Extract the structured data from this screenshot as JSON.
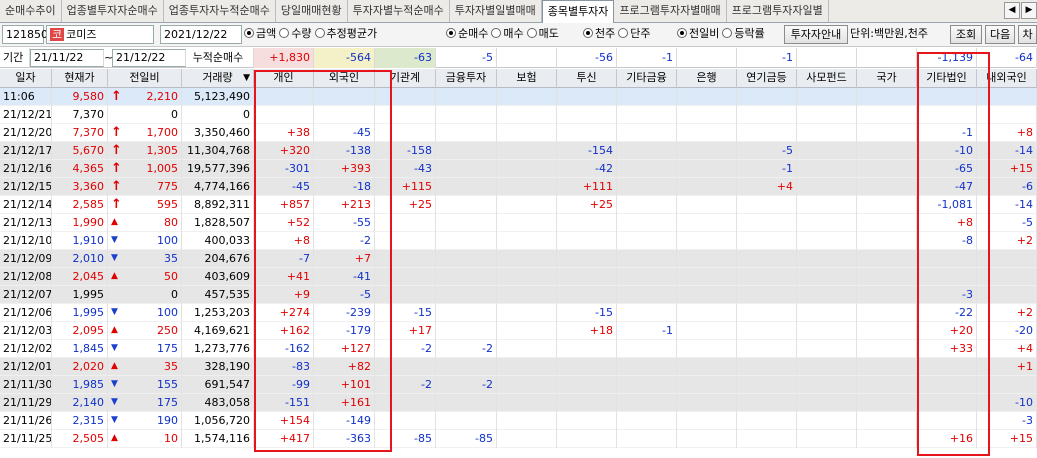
{
  "tabs": [
    "순매수추이",
    "업종별투자자순매수",
    "업종투자자누적순매수",
    "당일매매현황",
    "투자자별누적순매수",
    "투자자별일별매매",
    "종목별투자자",
    "프로그램투자자별매매",
    "프로그램투자자일별"
  ],
  "active_tab": 6,
  "tab_arrows": {
    "left": "◀",
    "right": "▶"
  },
  "toolbar": {
    "code": "121850",
    "market_tag": "코",
    "name": "코미즈",
    "date": "2021/12/22",
    "radios_value": [
      {
        "label": "금액",
        "on": true
      },
      {
        "label": "수량",
        "on": false
      },
      {
        "label": "추정평균가",
        "on": false
      }
    ],
    "radios_side": [
      {
        "label": "순매수",
        "on": true
      },
      {
        "label": "매수",
        "on": false
      },
      {
        "label": "매도",
        "on": false
      }
    ],
    "radios_unit": [
      {
        "label": "천주",
        "on": true
      },
      {
        "label": "단주",
        "on": false
      }
    ],
    "radios_cmp": [
      {
        "label": "전일비",
        "on": true
      },
      {
        "label": "등락률",
        "on": false
      }
    ],
    "investor_btn": "투자자안내",
    "unit_label": "단위:백만원,천주",
    "query_btn": "조회",
    "next_btn": "다음",
    "extra_btn": "차"
  },
  "period": {
    "label": "기간",
    "from": "21/11/22",
    "sep": "~",
    "to": "21/12/22",
    "cum_label": "누적순매수"
  },
  "cumulative": {
    "individual": "+1,830",
    "foreign": "-564",
    "institution": "-63",
    "fin_invest": "-5",
    "insurance": "",
    "trust": "-56",
    "other_fin": "-1",
    "bank": "",
    "pension": "-1",
    "pef": "",
    "nation": "",
    "other_corp": "-1,139",
    "dom_foreign": "-64"
  },
  "headers": [
    "일자",
    "현재가",
    "전일비",
    "거래량",
    "개인",
    "외국인",
    "기관계",
    "금융투자",
    "보험",
    "투신",
    "기타금융",
    "은행",
    "연기금등",
    "사모펀드",
    "국가",
    "기타법인",
    "내외국인"
  ],
  "sort_icon": "▼",
  "rows": [
    {
      "date": "11:06",
      "price": "9,580",
      "dir": "up",
      "chg": "2,210",
      "vol": "5,123,490",
      "ind": "",
      "for": "",
      "inst": "",
      "fin": "",
      "ins": "",
      "trust": "",
      "ofin": "",
      "bank": "",
      "pen": "",
      "pef": "",
      "nat": "",
      "ocorp": "",
      "dfor": "",
      "style": "now"
    },
    {
      "date": "21/12/21",
      "price": "7,370",
      "dir": "",
      "chg": "0",
      "vol": "0",
      "ind": "",
      "for": "",
      "inst": "",
      "fin": "",
      "ins": "",
      "trust": "",
      "ofin": "",
      "bank": "",
      "pen": "",
      "pef": "",
      "nat": "",
      "ocorp": "",
      "dfor": "",
      "style": ""
    },
    {
      "date": "21/12/20",
      "price": "7,370",
      "dir": "up",
      "chg": "1,700",
      "vol": "3,350,460",
      "ind": "+38",
      "for": "-45",
      "inst": "",
      "fin": "",
      "ins": "",
      "trust": "",
      "ofin": "",
      "bank": "",
      "pen": "",
      "pef": "",
      "nat": "",
      "ocorp": "-1",
      "dfor": "+8",
      "style": ""
    },
    {
      "date": "21/12/17",
      "price": "5,670",
      "dir": "up",
      "chg": "1,305",
      "vol": "11,304,768",
      "ind": "+320",
      "for": "-138",
      "inst": "-158",
      "fin": "",
      "ins": "",
      "trust": "-154",
      "ofin": "",
      "bank": "",
      "pen": "-5",
      "pef": "",
      "nat": "",
      "ocorp": "-10",
      "dfor": "-14",
      "style": "gray"
    },
    {
      "date": "21/12/16",
      "price": "4,365",
      "dir": "up",
      "chg": "1,005",
      "vol": "19,577,396",
      "ind": "-301",
      "for": "+393",
      "inst": "-43",
      "fin": "",
      "ins": "",
      "trust": "-42",
      "ofin": "",
      "bank": "",
      "pen": "-1",
      "pef": "",
      "nat": "",
      "ocorp": "-65",
      "dfor": "+15",
      "style": "gray"
    },
    {
      "date": "21/12/15",
      "price": "3,360",
      "dir": "up",
      "chg": "775",
      "vol": "4,774,166",
      "ind": "-45",
      "for": "-18",
      "inst": "+115",
      "fin": "",
      "ins": "",
      "trust": "+111",
      "ofin": "",
      "bank": "",
      "pen": "+4",
      "pef": "",
      "nat": "",
      "ocorp": "-47",
      "dfor": "-6",
      "style": "gray"
    },
    {
      "date": "21/12/14",
      "price": "2,585",
      "dir": "up",
      "chg": "595",
      "vol": "8,892,311",
      "ind": "+857",
      "for": "+213",
      "inst": "+25",
      "fin": "",
      "ins": "",
      "trust": "+25",
      "ofin": "",
      "bank": "",
      "pen": "",
      "pef": "",
      "nat": "",
      "ocorp": "-1,081",
      "dfor": "-14",
      "style": ""
    },
    {
      "date": "21/12/13",
      "price": "1,990",
      "dir": "tri-up",
      "chg": "80",
      "vol": "1,828,507",
      "ind": "+52",
      "for": "-55",
      "inst": "",
      "fin": "",
      "ins": "",
      "trust": "",
      "ofin": "",
      "bank": "",
      "pen": "",
      "pef": "",
      "nat": "",
      "ocorp": "+8",
      "dfor": "-5",
      "style": ""
    },
    {
      "date": "21/12/10",
      "price": "1,910",
      "dir": "tri-dn",
      "chg": "100",
      "vol": "400,033",
      "ind": "+8",
      "for": "-2",
      "inst": "",
      "fin": "",
      "ins": "",
      "trust": "",
      "ofin": "",
      "bank": "",
      "pen": "",
      "pef": "",
      "nat": "",
      "ocorp": "-8",
      "dfor": "+2",
      "style": ""
    },
    {
      "date": "21/12/09",
      "price": "2,010",
      "dir": "tri-dn",
      "chg": "35",
      "vol": "204,676",
      "ind": "-7",
      "for": "+7",
      "inst": "",
      "fin": "",
      "ins": "",
      "trust": "",
      "ofin": "",
      "bank": "",
      "pen": "",
      "pef": "",
      "nat": "",
      "ocorp": "",
      "dfor": "",
      "style": "gray"
    },
    {
      "date": "21/12/08",
      "price": "2,045",
      "dir": "tri-up",
      "chg": "50",
      "vol": "403,609",
      "ind": "+41",
      "for": "-41",
      "inst": "",
      "fin": "",
      "ins": "",
      "trust": "",
      "ofin": "",
      "bank": "",
      "pen": "",
      "pef": "",
      "nat": "",
      "ocorp": "",
      "dfor": "",
      "style": "gray"
    },
    {
      "date": "21/12/07",
      "price": "1,995",
      "dir": "",
      "chg": "0",
      "vol": "457,535",
      "ind": "+9",
      "for": "-5",
      "inst": "",
      "fin": "",
      "ins": "",
      "trust": "",
      "ofin": "",
      "bank": "",
      "pen": "",
      "pef": "",
      "nat": "",
      "ocorp": "-3",
      "dfor": "",
      "style": "gray"
    },
    {
      "date": "21/12/06",
      "price": "1,995",
      "dir": "tri-dn",
      "chg": "100",
      "vol": "1,253,203",
      "ind": "+274",
      "for": "-239",
      "inst": "-15",
      "fin": "",
      "ins": "",
      "trust": "-15",
      "ofin": "",
      "bank": "",
      "pen": "",
      "pef": "",
      "nat": "",
      "ocorp": "-22",
      "dfor": "+2",
      "style": ""
    },
    {
      "date": "21/12/03",
      "price": "2,095",
      "dir": "tri-up",
      "chg": "250",
      "vol": "4,169,621",
      "ind": "+162",
      "for": "-179",
      "inst": "+17",
      "fin": "",
      "ins": "",
      "trust": "+18",
      "ofin": "-1",
      "bank": "",
      "pen": "",
      "pef": "",
      "nat": "",
      "ocorp": "+20",
      "dfor": "-20",
      "style": ""
    },
    {
      "date": "21/12/02",
      "price": "1,845",
      "dir": "tri-dn",
      "chg": "175",
      "vol": "1,273,776",
      "ind": "-162",
      "for": "+127",
      "inst": "-2",
      "fin": "-2",
      "ins": "",
      "trust": "",
      "ofin": "",
      "bank": "",
      "pen": "",
      "pef": "",
      "nat": "",
      "ocorp": "+33",
      "dfor": "+4",
      "style": ""
    },
    {
      "date": "21/12/01",
      "price": "2,020",
      "dir": "tri-up",
      "chg": "35",
      "vol": "328,190",
      "ind": "-83",
      "for": "+82",
      "inst": "",
      "fin": "",
      "ins": "",
      "trust": "",
      "ofin": "",
      "bank": "",
      "pen": "",
      "pef": "",
      "nat": "",
      "ocorp": "",
      "dfor": "+1",
      "style": "gray"
    },
    {
      "date": "21/11/30",
      "price": "1,985",
      "dir": "tri-dn",
      "chg": "155",
      "vol": "691,547",
      "ind": "-99",
      "for": "+101",
      "inst": "-2",
      "fin": "-2",
      "ins": "",
      "trust": "",
      "ofin": "",
      "bank": "",
      "pen": "",
      "pef": "",
      "nat": "",
      "ocorp": "",
      "dfor": "",
      "style": "gray"
    },
    {
      "date": "21/11/29",
      "price": "2,140",
      "dir": "tri-dn",
      "chg": "175",
      "vol": "483,058",
      "ind": "-151",
      "for": "+161",
      "inst": "",
      "fin": "",
      "ins": "",
      "trust": "",
      "ofin": "",
      "bank": "",
      "pen": "",
      "pef": "",
      "nat": "",
      "ocorp": "",
      "dfor": "-10",
      "style": "gray"
    },
    {
      "date": "21/11/26",
      "price": "2,315",
      "dir": "tri-dn",
      "chg": "190",
      "vol": "1,056,720",
      "ind": "+154",
      "for": "-149",
      "inst": "",
      "fin": "",
      "ins": "",
      "trust": "",
      "ofin": "",
      "bank": "",
      "pen": "",
      "pef": "",
      "nat": "",
      "ocorp": "",
      "dfor": "-3",
      "style": ""
    },
    {
      "date": "21/11/25",
      "price": "2,505",
      "dir": "tri-up",
      "chg": "10",
      "vol": "1,574,116",
      "ind": "+417",
      "for": "-363",
      "inst": "-85",
      "fin": "-85",
      "ins": "",
      "trust": "",
      "ofin": "",
      "bank": "",
      "pen": "",
      "pef": "",
      "nat": "",
      "ocorp": "+16",
      "dfor": "+15",
      "style": ""
    }
  ],
  "colors": {
    "up": "#e00000",
    "down": "#1030c8",
    "highlight": "#e8141c"
  }
}
